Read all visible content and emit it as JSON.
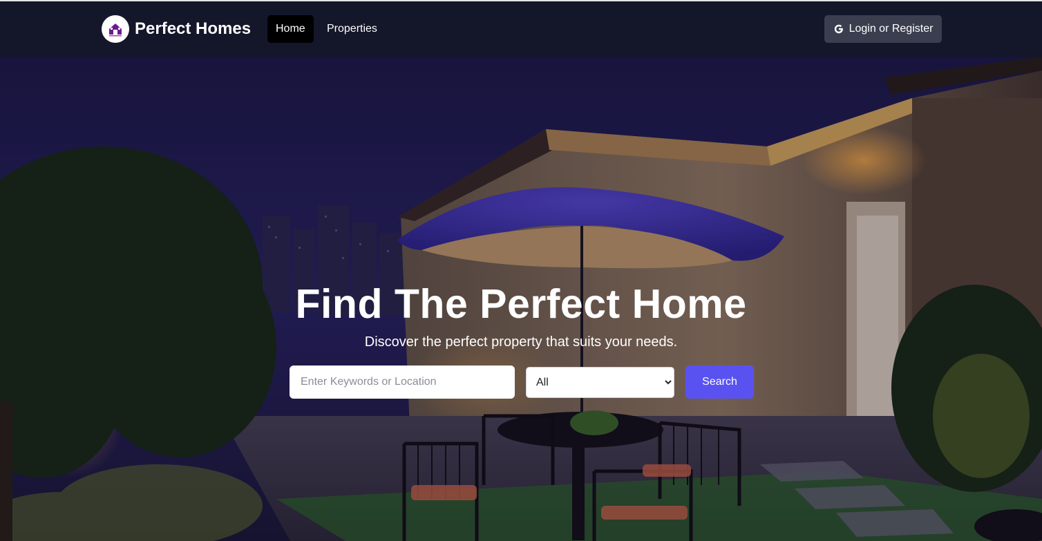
{
  "header": {
    "brand": "Perfect Homes",
    "logo_icon": "house-logo-icon",
    "nav": [
      {
        "label": "Home",
        "active": true
      },
      {
        "label": "Properties",
        "active": false
      }
    ],
    "login_label": "Login or Register",
    "login_icon": "google-icon"
  },
  "hero": {
    "title": "Find The Perfect Home",
    "subtitle": "Discover the perfect property that suits your needs.",
    "search": {
      "placeholder": "Enter Keywords or Location",
      "value": "",
      "type_selected": "All",
      "button_label": "Search"
    },
    "background": "night rooftop patio with umbrella, table and chairs"
  },
  "colors": {
    "navbar": "#14162a",
    "accent": "#5a52f0",
    "login_button": "#3a3e4f"
  }
}
